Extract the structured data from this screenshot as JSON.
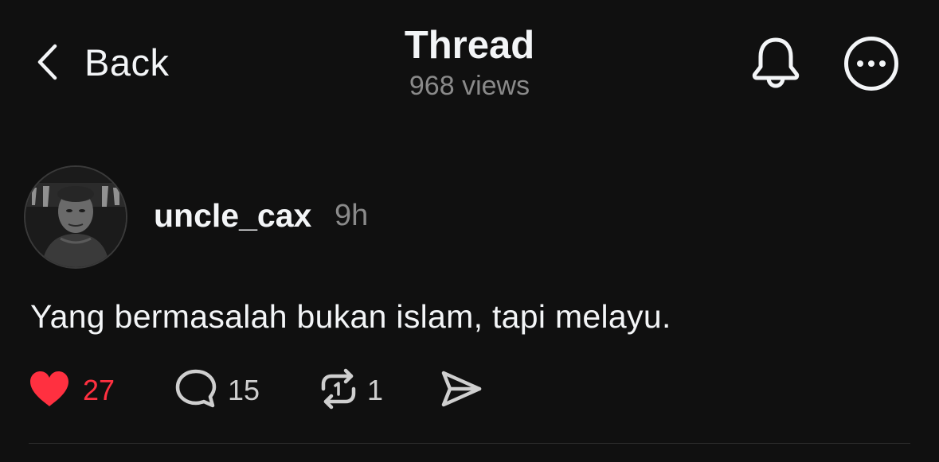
{
  "header": {
    "back_label": "Back",
    "title": "Thread",
    "views": "968 views"
  },
  "post": {
    "username": "uncle_cax",
    "time": "9h",
    "text": "Yang bermasalah bukan islam, tapi melayu.",
    "avatar_icon": "profile-photo",
    "likes": "27",
    "replies": "15",
    "reposts": "1"
  },
  "colors": {
    "background": "#101010",
    "like_active": "#ff3040",
    "secondary_text": "#8a8a8a"
  },
  "icons": [
    "chevron-left-icon",
    "bell-icon",
    "more-icon",
    "heart-icon",
    "comment-icon",
    "repost-icon",
    "send-icon"
  ]
}
